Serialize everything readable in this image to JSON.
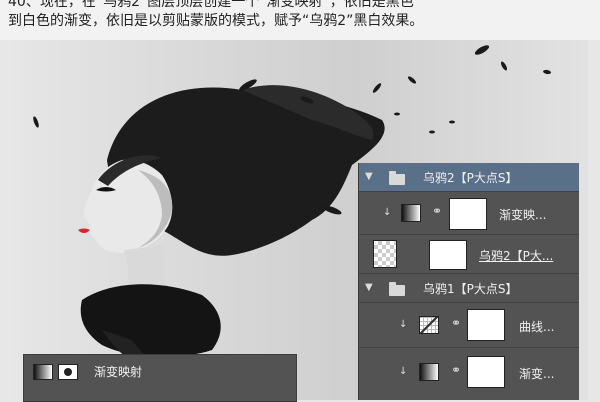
{
  "caption": {
    "line1": "40、现在，在“乌鸦2”图层顶层创建一个“渐变映射”，依旧是黑色",
    "line2": "到白色的渐变，依旧是以剪贴蒙版的模式，赋予“乌鸦2”黑白效果。"
  },
  "layers_panel": {
    "group1": {
      "name": "乌鸦2【P大点S】",
      "selected": true
    },
    "row_gradient_map": {
      "name": "渐变映..."
    },
    "row_crow2_layer": {
      "name": "乌鸦2【P大..."
    },
    "group2": {
      "name": "乌鸦1【P大点S】"
    },
    "row_curves": {
      "name": "曲线..."
    },
    "row_gradient_map2": {
      "name": "渐变..."
    }
  },
  "properties_panel": {
    "title": "渐变映射"
  },
  "colors": {
    "panel_bg": "#535353",
    "selected_row": "#5a6f88",
    "caption_bg": "#f2f2f2"
  }
}
